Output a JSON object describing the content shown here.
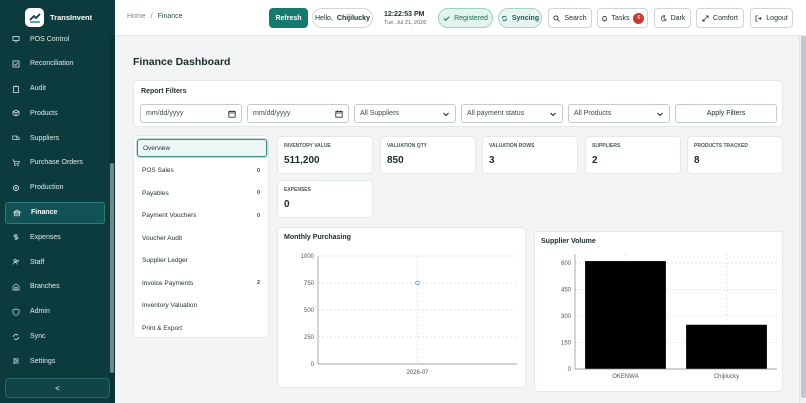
{
  "app": {
    "name": "TransInvent"
  },
  "sidebar": {
    "items": [
      {
        "label": "POS Control",
        "icon": "monitor-icon"
      },
      {
        "label": "Reconciliation",
        "icon": "checklist-icon"
      },
      {
        "label": "Audit",
        "icon": "clipboard-icon"
      },
      {
        "label": "Products",
        "icon": "box-icon"
      },
      {
        "label": "Suppliers",
        "icon": "truck-icon"
      },
      {
        "label": "Purchase Orders",
        "icon": "cart-icon"
      },
      {
        "label": "Production",
        "icon": "gear-icon"
      },
      {
        "label": "Finance",
        "icon": "bank-icon",
        "active": true
      },
      {
        "label": "Expenses",
        "icon": "dollar-icon"
      },
      {
        "label": "Staff",
        "icon": "users-icon"
      },
      {
        "label": "Branches",
        "icon": "branch-icon"
      },
      {
        "label": "Admin",
        "icon": "shield-icon"
      },
      {
        "label": "Sync",
        "icon": "sync-icon"
      },
      {
        "label": "Settings",
        "icon": "sliders-icon"
      }
    ],
    "collapse_label": "<"
  },
  "topbar": {
    "breadcrumb_home": "Home",
    "breadcrumb_sep": "/",
    "breadcrumb_current": "Finance",
    "refresh_label": "Refresh",
    "hello_prefix": "Hello,",
    "user_name": "Chijilucky",
    "time": "12:22:53 PM",
    "date": "Tue, Jul 21, 2026",
    "registered_label": "Registered",
    "syncing_label": "Syncing",
    "search_label": "Search",
    "tasks_label": "Tasks",
    "tasks_count": "6",
    "dark_label": "Dark",
    "comfort_label": "Comfort",
    "logout_label": "Logout"
  },
  "main": {
    "title": "Finance Dashboard",
    "filters": {
      "title": "Report Filters",
      "date_from_placeholder": "mm/dd/yyyy",
      "date_to_placeholder": "mm/dd/yyyy",
      "supplier": "All Suppliers",
      "payment_status": "All payment status",
      "product": "All Products",
      "apply_label": "Apply Filters"
    },
    "tabs": [
      {
        "label": "Overview",
        "count": "",
        "active": true
      },
      {
        "label": "POS Sales",
        "count": "0"
      },
      {
        "label": "Payables",
        "count": "0"
      },
      {
        "label": "Payment Vouchers",
        "count": "0"
      },
      {
        "label": "Voucher Audit",
        "count": ""
      },
      {
        "label": "Supplier Ledger",
        "count": ""
      },
      {
        "label": "Invoice Payments",
        "count": "2"
      },
      {
        "label": "Inventory Valuation",
        "count": ""
      },
      {
        "label": "Print & Export",
        "count": ""
      }
    ],
    "kpis": [
      {
        "label": "Inventory Value",
        "value": "511,200"
      },
      {
        "label": "Valuation Qty",
        "value": "850"
      },
      {
        "label": "Valuation Rows",
        "value": "3"
      },
      {
        "label": "Suppliers",
        "value": "2"
      },
      {
        "label": "Products Tracked",
        "value": "8"
      },
      {
        "label": "Expenses",
        "value": "0"
      }
    ]
  },
  "chart_data": [
    {
      "type": "scatter",
      "title": "Monthly Purchasing",
      "x": [
        "2026-07"
      ],
      "y": [
        750
      ],
      "ylim": [
        0,
        1000
      ],
      "yticks": [
        0,
        250,
        500,
        750,
        1000
      ],
      "grid": true,
      "color": "#5aa6c8"
    },
    {
      "type": "bar",
      "title": "Supplier Volume",
      "categories": [
        "OKENWA",
        "Chijilucky"
      ],
      "values": [
        610,
        250
      ],
      "ylim": [
        0,
        650
      ],
      "yticks": [
        0,
        150,
        300,
        450,
        600
      ],
      "grid": true,
      "color": "#000000"
    }
  ]
}
